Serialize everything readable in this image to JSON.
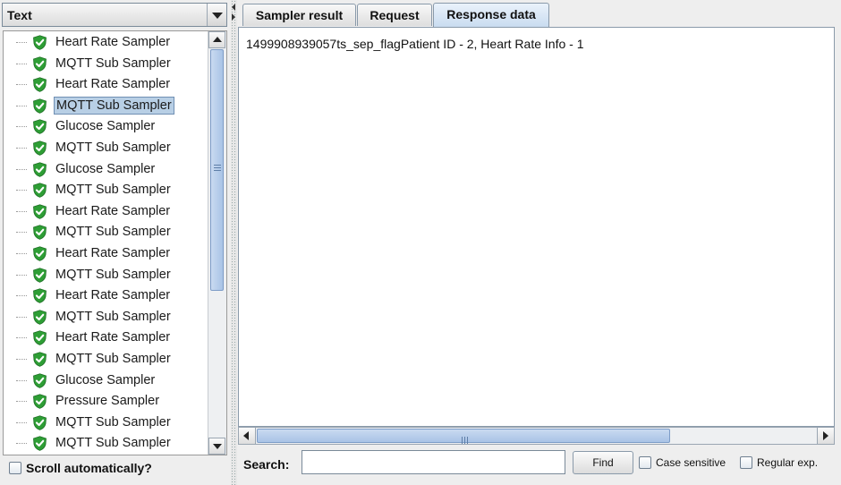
{
  "renderer": {
    "selected": "Text"
  },
  "tree": {
    "selected_index": 3,
    "items": [
      {
        "label": "Heart Rate Sampler",
        "status": "success"
      },
      {
        "label": "MQTT Sub Sampler",
        "status": "success"
      },
      {
        "label": "Heart Rate Sampler",
        "status": "success"
      },
      {
        "label": "MQTT Sub Sampler",
        "status": "success"
      },
      {
        "label": "Glucose Sampler",
        "status": "success"
      },
      {
        "label": "MQTT Sub Sampler",
        "status": "success"
      },
      {
        "label": "Glucose Sampler",
        "status": "success"
      },
      {
        "label": "MQTT Sub Sampler",
        "status": "success"
      },
      {
        "label": "Heart Rate Sampler",
        "status": "success"
      },
      {
        "label": "MQTT Sub Sampler",
        "status": "success"
      },
      {
        "label": "Heart Rate Sampler",
        "status": "success"
      },
      {
        "label": "MQTT Sub Sampler",
        "status": "success"
      },
      {
        "label": "Heart Rate Sampler",
        "status": "success"
      },
      {
        "label": "MQTT Sub Sampler",
        "status": "success"
      },
      {
        "label": "Heart Rate Sampler",
        "status": "success"
      },
      {
        "label": "MQTT Sub Sampler",
        "status": "success"
      },
      {
        "label": "Glucose Sampler",
        "status": "success"
      },
      {
        "label": "Pressure Sampler",
        "status": "success"
      },
      {
        "label": "MQTT Sub Sampler",
        "status": "success"
      },
      {
        "label": "MQTT Sub Sampler",
        "status": "success"
      }
    ]
  },
  "scroll_automatically": {
    "label": "Scroll automatically?",
    "checked": false
  },
  "tabs": [
    {
      "label": "Sampler result",
      "active": false
    },
    {
      "label": "Request",
      "active": false
    },
    {
      "label": "Response data",
      "active": true
    }
  ],
  "response": {
    "text": "1499908939057ts_sep_flagPatient ID - 2, Heart Rate Info - 1"
  },
  "search": {
    "label": "Search:",
    "value": "",
    "find_label": "Find",
    "case_sensitive_label": "Case sensitive",
    "regular_exp_label": "Regular exp."
  },
  "icons": {
    "success": "shield-check-icon"
  },
  "colors": {
    "success_green": "#2e9e35",
    "selection_bg": "#b8cfe5",
    "active_tab": "#c9dcf0"
  }
}
